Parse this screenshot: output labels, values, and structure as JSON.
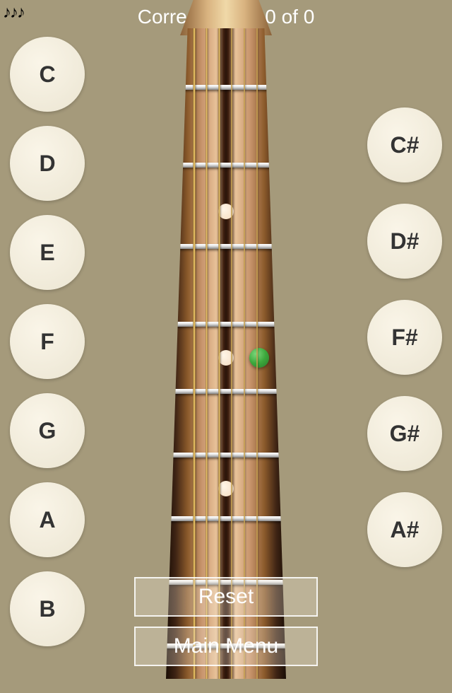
{
  "header": {
    "score_text": "Correct Notes 0 of 0"
  },
  "notes_left": [
    "C",
    "D",
    "E",
    "F",
    "G",
    "A",
    "B"
  ],
  "notes_right": [
    "C#",
    "D#",
    "F#",
    "G#",
    "A#"
  ],
  "actions": {
    "reset": "Reset",
    "main_menu": "Main Menu"
  },
  "music_icon": "♪♪♪"
}
